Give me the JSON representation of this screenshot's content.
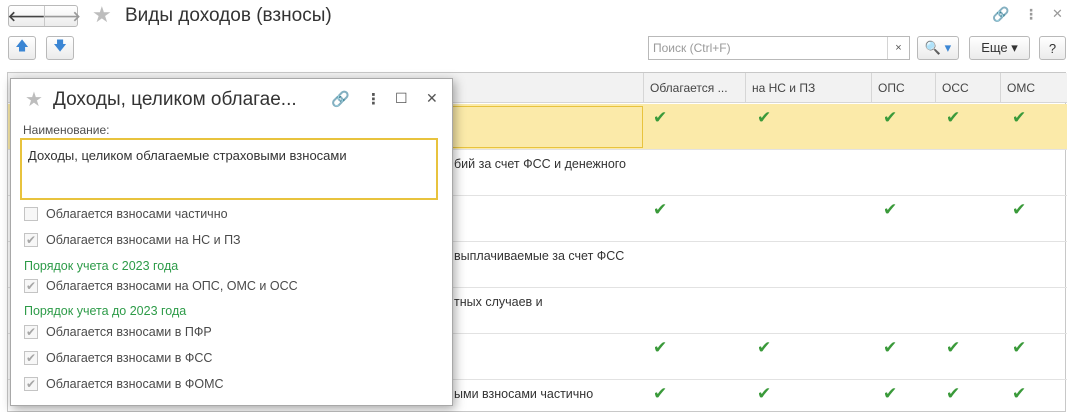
{
  "window": {
    "title": "Виды доходов (взносы)",
    "back_symbol": "🡐",
    "forward_symbol": "🡒",
    "star_symbol": "★",
    "link_symbol": "🔗",
    "menu_symbol": "⋮",
    "close_symbol": "✕"
  },
  "toolbar": {
    "up_symbol": "🡅",
    "down_symbol": "🡇",
    "search_placeholder": "Поиск (Ctrl+F)",
    "search_clear": "×",
    "search_button": "🔍 ▾",
    "more_label": "Еще ▾",
    "help_label": "?"
  },
  "grid": {
    "columns": [
      "Облагается ...",
      "на НС и ПЗ",
      "ОПС",
      "ОСС",
      "ОМС"
    ],
    "check_symbol": "✔",
    "rows": [
      {
        "name": "",
        "checks": [
          true,
          true,
          true,
          true,
          true
        ],
        "selected": true
      },
      {
        "name": "бий за счет ФСС и денежного",
        "checks": [
          false,
          false,
          false,
          false,
          false
        ],
        "selected": false
      },
      {
        "name": "",
        "checks": [
          true,
          false,
          true,
          false,
          true
        ],
        "selected": false
      },
      {
        "name": "выплачиваемые за счет ФСС",
        "checks": [
          false,
          false,
          false,
          false,
          false
        ],
        "selected": false
      },
      {
        "name": "тных случаев и",
        "checks": [
          false,
          false,
          false,
          false,
          false
        ],
        "selected": false
      },
      {
        "name": "",
        "checks": [
          true,
          true,
          true,
          true,
          true
        ],
        "selected": false
      },
      {
        "name": "ыми взносами частично",
        "checks": [
          true,
          true,
          true,
          true,
          true
        ],
        "selected": false
      }
    ]
  },
  "dialog": {
    "title": "Доходы, целиком облагае...",
    "link_symbol": "🔗",
    "menu_symbol": "⋮",
    "maximize_symbol": "☐",
    "close_symbol": "✕",
    "name_label": "Наименование:",
    "name_value": "Доходы, целиком облагаемые страховыми взносами",
    "checkmark": "✔",
    "checkboxes_top": [
      {
        "label": "Облагается взносами частично",
        "checked": false
      },
      {
        "label": "Облагается взносами на НС и ПЗ",
        "checked": true
      }
    ],
    "group_2023": {
      "title": "Порядок учета с 2023 года",
      "items": [
        {
          "label": "Облагается взносами на ОПС, ОМС и ОСС",
          "checked": true
        }
      ]
    },
    "group_before_2023": {
      "title": "Порядок учета до 2023 года",
      "items": [
        {
          "label": "Облагается взносами в ПФР",
          "checked": true
        },
        {
          "label": "Облагается взносами в ФСС",
          "checked": true
        },
        {
          "label": "Облагается взносами в ФОМС",
          "checked": true
        }
      ]
    }
  }
}
